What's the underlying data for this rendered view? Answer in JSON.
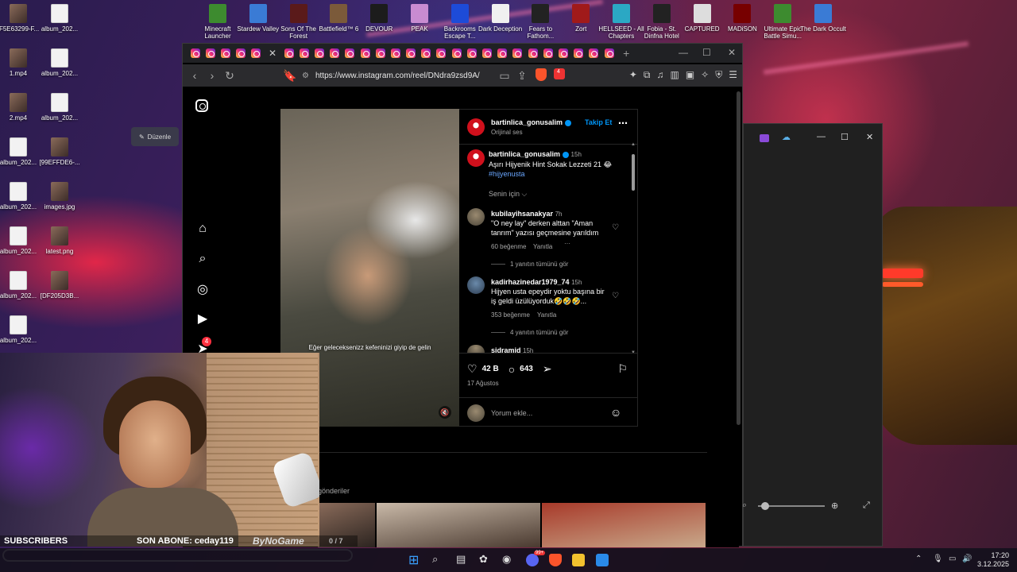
{
  "desktop_left": [
    {
      "label": "[F5E63299-F...",
      "kind": "img"
    },
    {
      "label": "album_202...",
      "kind": "file"
    },
    {
      "label": "1.mp4",
      "kind": "img"
    },
    {
      "label": "album_202...",
      "kind": "file"
    },
    {
      "label": "2.mp4",
      "kind": "img"
    },
    {
      "label": "album_202...",
      "kind": "file"
    },
    {
      "label": "album_202...",
      "kind": "file"
    },
    {
      "label": "[99EFFDE6-...",
      "kind": "img"
    },
    {
      "label": "album_202...",
      "kind": "file"
    },
    {
      "label": "images.jpg",
      "kind": "img"
    },
    {
      "label": "album_202...",
      "kind": "file"
    },
    {
      "label": "latest.png",
      "kind": "img"
    },
    {
      "label": "album_202...",
      "kind": "file"
    },
    {
      "label": "[DF205D3B...",
      "kind": "img"
    },
    {
      "label": "album_202...",
      "kind": "file"
    }
  ],
  "desktop_top": [
    {
      "label": "Minecraft Launcher"
    },
    {
      "label": "Stardew Valley"
    },
    {
      "label": "Sons Of The Forest"
    },
    {
      "label": "Battlefield™ 6"
    },
    {
      "label": "DEVOUR"
    },
    {
      "label": "PEAK"
    },
    {
      "label": "Backrooms Escape T..."
    },
    {
      "label": "Dark Deception"
    },
    {
      "label": "Fears to Fathom..."
    },
    {
      "label": "Zort"
    },
    {
      "label": "HELLSEED - All Chapters"
    },
    {
      "label": "Fobia - St. Dinfna Hotel"
    },
    {
      "label": "CAPTURED"
    },
    {
      "label": "MADiSON"
    },
    {
      "label": "Ultimate Epic Battle Simu..."
    },
    {
      "label": "The Dark Occult"
    }
  ],
  "browser": {
    "url": "https://www.instagram.com/reel/DNdra9zsd9A/",
    "rewards_badge": "4"
  },
  "instagram": {
    "notif_count": "4",
    "reel_caption": "Eğer geleceksenizz kefeninizi giyip de gelin",
    "author": {
      "username": "bartinlica_gonusalim",
      "audio": "Orijinal ses",
      "follow_label": "Takip Et"
    },
    "post": {
      "username": "bartinlica_gonusalim",
      "time": "15h",
      "caption": "Aşırı Hijyenik Hint Sokak Lezzeti 21 😂",
      "hashtag": "#hijyenusta",
      "for_you": "Senin için ⌵"
    },
    "comments": [
      {
        "username": "kubilayihsanakyar",
        "time": "7h",
        "text": "\"O ney lay\" derken alttan \"Aman tanrım\" yazısı geçmesine yarıldım",
        "likes": "60 beğenme",
        "reply": "Yanıtla",
        "more": "1 yanıtın tümünü gör"
      },
      {
        "username": "kadirhazinedar1979_74",
        "time": "15h",
        "text": "Hijyen usta epeydir yoktu başına bir iş geldi üzülüyorduk🤣🤣🤣...",
        "likes": "353 beğenme",
        "reply": "Yanıtla",
        "more": "4 yanıtın tümünü gör"
      },
      {
        "username": "sidramid",
        "time": "15h"
      }
    ],
    "like_count": "42 B",
    "comment_count": "643",
    "date": "17 Ağustos",
    "comment_placeholder": "Yorum ekle...",
    "gonderiler_label": "gönderiler"
  },
  "duzenle_label": "Düzenle",
  "stream": {
    "subscribers_label": "SUBSCRIBERS",
    "last_sub": "SON ABONE: ceday119",
    "brand": "ByNoGame",
    "progress_text": "0 / 7",
    "progress_value": 0
  },
  "clock": {
    "time": "17:20",
    "date": "3.12.2025"
  },
  "taskbar_badge": "99+"
}
